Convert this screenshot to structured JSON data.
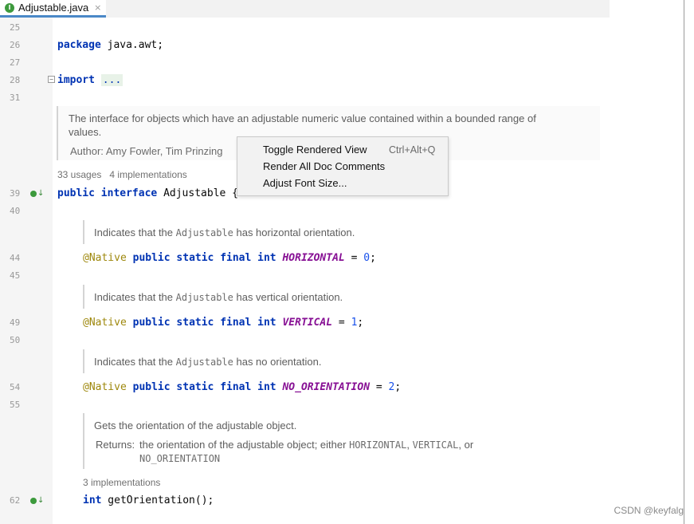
{
  "tab": {
    "label": "Adjustable.java",
    "icon": "interface-icon",
    "icon_letter": "I",
    "close": "×"
  },
  "gutter": {
    "line_numbers": [
      "25",
      "26",
      "27",
      "28",
      "31",
      "39",
      "40",
      "44",
      "45",
      "49",
      "50",
      "54",
      "55",
      "62"
    ]
  },
  "code": {
    "package_kw": "package",
    "package_name": " java.awt;",
    "import_kw": "import",
    "import_fold": "...",
    "decl_public": "public",
    "decl_interface": "interface",
    "decl_name": " Adjustable {",
    "native": "@Native",
    "mods": "public static final int",
    "horizontal": "HORIZONTAL",
    "horizontal_val": "0",
    "vertical": "VERTICAL",
    "vertical_val": "1",
    "no_orientation": "NO_ORIENTATION",
    "no_orientation_val": "2",
    "method_type": "int",
    "method_sig": " getOrientation();",
    "eq": " = ",
    "semi": ";"
  },
  "docs": {
    "class_doc_line1": "The interface for objects which have an adjustable numeric value contained within a bounded range of",
    "class_doc_line2": "values.",
    "class_author_label": "Author:",
    "class_author": "Amy Fowler, Tim Prinzing",
    "class_usages": "33 usages",
    "class_impls": "4 implementations",
    "h_prefix": "Indicates that the ",
    "h_code": "Adjustable",
    "h_suffix": " has horizontal orientation.",
    "v_prefix": "Indicates that the ",
    "v_code": "Adjustable",
    "v_suffix": " has vertical orientation.",
    "n_prefix": "Indicates that the ",
    "n_code": "Adjustable",
    "n_suffix": " has no orientation.",
    "m_desc": "Gets the orientation of the adjustable object.",
    "m_returns_label": "Returns:",
    "m_returns_text": "the orientation of the adjustable object; either ",
    "m_returns_c1": "HORIZONTAL",
    "m_returns_sep": ", ",
    "m_returns_c2": "VERTICAL",
    "m_returns_or": ", or",
    "m_returns_c3": "NO_ORIENTATION",
    "m_impls": "3 implementations"
  },
  "context_menu": {
    "items": [
      {
        "label": "Toggle Rendered View",
        "shortcut": "Ctrl+Alt+Q"
      },
      {
        "label": "Render All Doc Comments",
        "shortcut": ""
      },
      {
        "label": "Adjust Font Size...",
        "shortcut": ""
      }
    ]
  },
  "watermark": "CSDN @keyfalg",
  "colors": {
    "keyword": "#0033b3",
    "annotation": "#9e880d",
    "constant": "#871094",
    "number": "#1750eb",
    "tab_accent": "#4a88c7"
  }
}
